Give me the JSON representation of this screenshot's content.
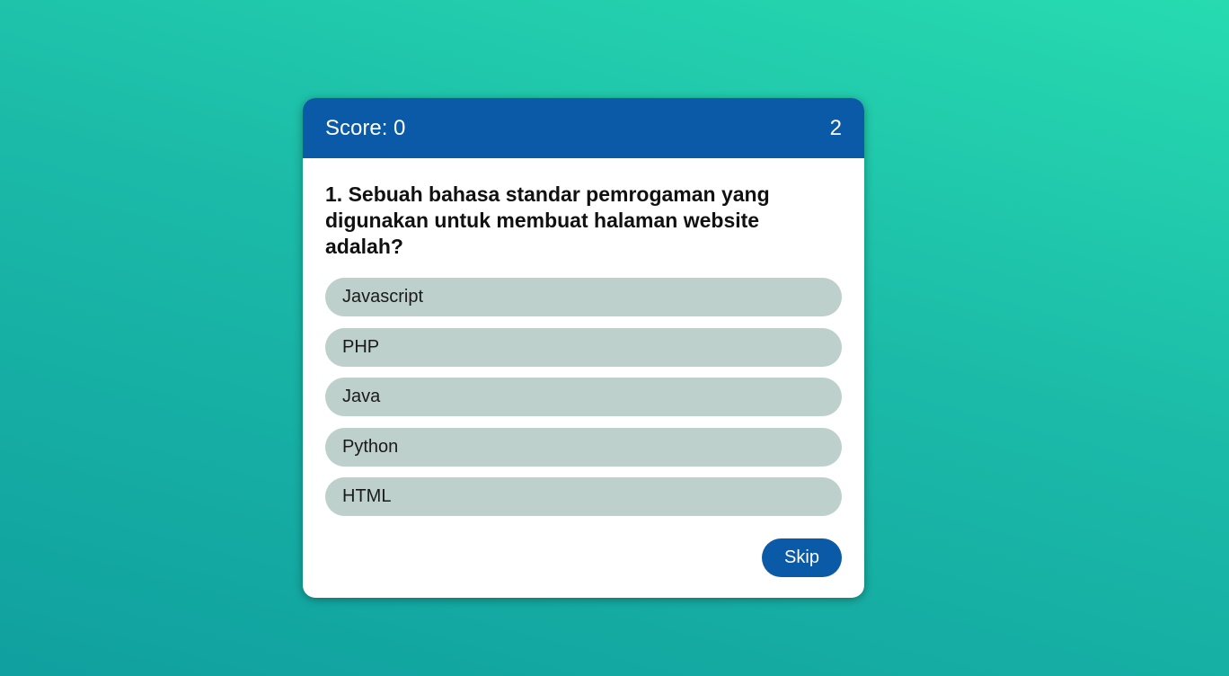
{
  "header": {
    "score_label": "Score: 0",
    "timer": "2"
  },
  "question": {
    "text": "1. Sebuah bahasa standar pemrogaman yang digunakan untuk membuat halaman website adalah?"
  },
  "options": [
    {
      "label": "Javascript"
    },
    {
      "label": "PHP"
    },
    {
      "label": "Java"
    },
    {
      "label": "Python"
    },
    {
      "label": "HTML"
    }
  ],
  "footer": {
    "skip_label": "Skip"
  },
  "colors": {
    "header_bg": "#0b5aa7",
    "option_bg": "#bdd0cb",
    "button_bg": "#0b5aa7",
    "background_start": "#27dbb0",
    "background_end": "#10a09f"
  }
}
